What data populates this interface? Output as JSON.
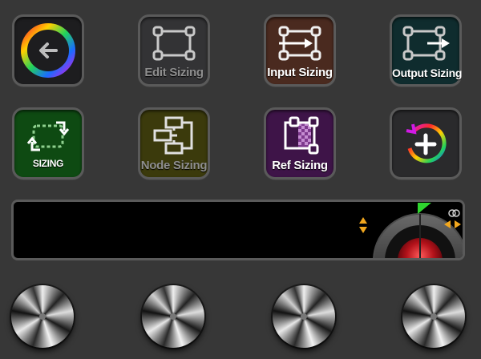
{
  "buttons": {
    "back": {
      "label": ""
    },
    "edit_sizing": {
      "label": "Edit Sizing"
    },
    "input_sizing": {
      "label": "Input Sizing"
    },
    "output_sizing": {
      "label": "Output Sizing"
    },
    "sizing": {
      "label": "SIZING"
    },
    "node_sizing": {
      "label": "Node Sizing"
    },
    "ref_sizing": {
      "label": "Ref Sizing"
    },
    "add": {
      "label": ""
    }
  },
  "icons": {
    "back": "color-wheel-back-arrow-icon",
    "edit": "resize-frame-icon",
    "input": "resize-frame-input-arrow-icon",
    "output": "resize-frame-output-arrow-icon",
    "sizing": "rotate-frame-icon",
    "node": "node-graph-icon",
    "ref": "reference-frame-icon",
    "add": "color-wheel-add-icon",
    "trackball": "trackball-icon"
  },
  "colors": {
    "background": "#373737",
    "button_border": "#5a5a5a",
    "input_bg": "#4a2a1f",
    "output_bg": "#0f2c2e",
    "sizing_bg": "#0e4a12",
    "node_bg": "#3b3a0c",
    "ref_bg": "#3e1448",
    "accent_green": "#2ed52e",
    "accent_orange": "#f0a61e"
  }
}
